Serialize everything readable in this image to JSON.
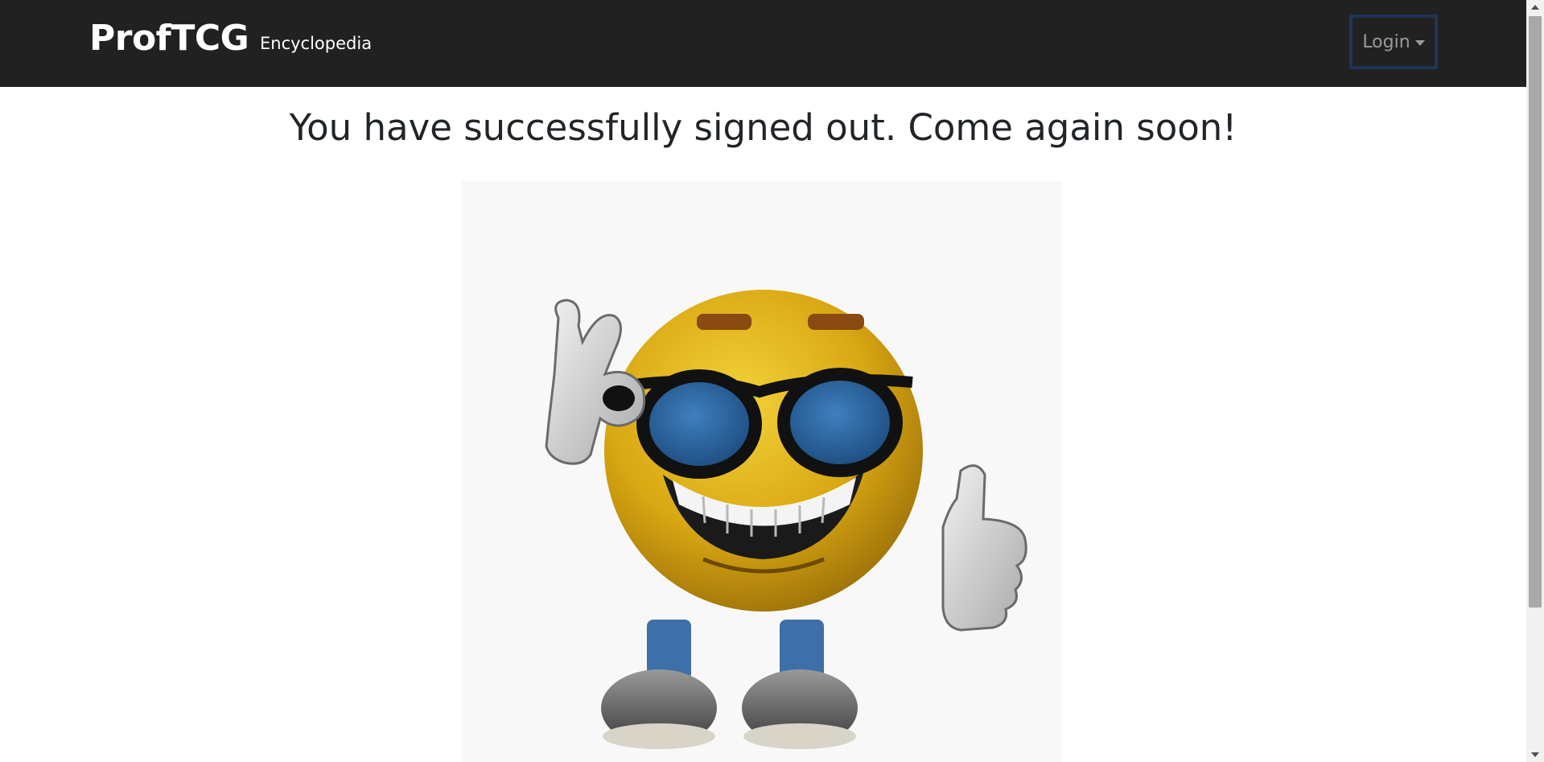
{
  "navbar": {
    "brand": "ProfTCG",
    "links": [
      {
        "label": "Encyclopedia"
      }
    ],
    "login_label": "Login",
    "background": "#212121",
    "login_focus_border": "#1f3558"
  },
  "main": {
    "heading": "You have successfully signed out. Come again soon!",
    "image": {
      "icon": "cool-smiley-sunglasses-thumbs-up-icon"
    }
  }
}
